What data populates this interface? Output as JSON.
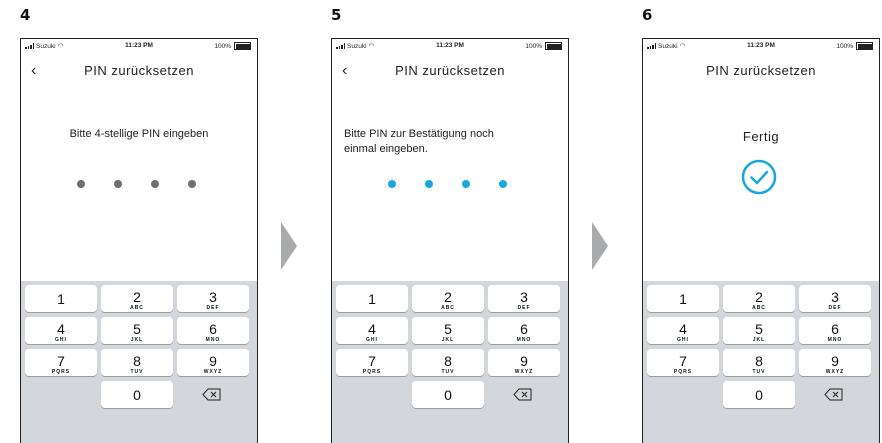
{
  "steps": [
    {
      "number": "4",
      "status": {
        "carrier": "Suzuki",
        "time": "11:23 PM",
        "battery": "100%"
      },
      "title": "PIN zurücksetzen",
      "has_back": true,
      "message": "Bitte 4-stellige PIN eingeben",
      "dots_color": "#6d6e72",
      "state": "entry"
    },
    {
      "number": "5",
      "status": {
        "carrier": "Suzuki",
        "time": "11:23 PM",
        "battery": "100%"
      },
      "title": "PIN zurücksetzen",
      "has_back": true,
      "message_line1": "Bitte PIN zur Bestätigung noch",
      "message_line2": "einmal eingeben.",
      "dots_color": "#1aa7e0",
      "state": "confirm"
    },
    {
      "number": "6",
      "status": {
        "carrier": "Suzuki",
        "time": "11:23 PM",
        "battery": "100%"
      },
      "title": "PIN zurücksetzen",
      "has_back": false,
      "done_label": "Fertig",
      "check_color": "#1aa7e0",
      "state": "done"
    }
  ],
  "keypad": [
    {
      "digit": "1",
      "letters": ""
    },
    {
      "digit": "2",
      "letters": "ABC"
    },
    {
      "digit": "3",
      "letters": "DEF"
    },
    {
      "digit": "4",
      "letters": "GHI"
    },
    {
      "digit": "5",
      "letters": "JKL"
    },
    {
      "digit": "6",
      "letters": "MNO"
    },
    {
      "digit": "7",
      "letters": "PQRS"
    },
    {
      "digit": "8",
      "letters": "TUV"
    },
    {
      "digit": "9",
      "letters": "WXYZ"
    },
    {
      "digit": "0",
      "letters": ""
    }
  ],
  "icons": {
    "back": "chevron-left-icon",
    "backspace": "backspace-icon",
    "success": "check-circle-icon",
    "next": "arrow-right-icon"
  }
}
